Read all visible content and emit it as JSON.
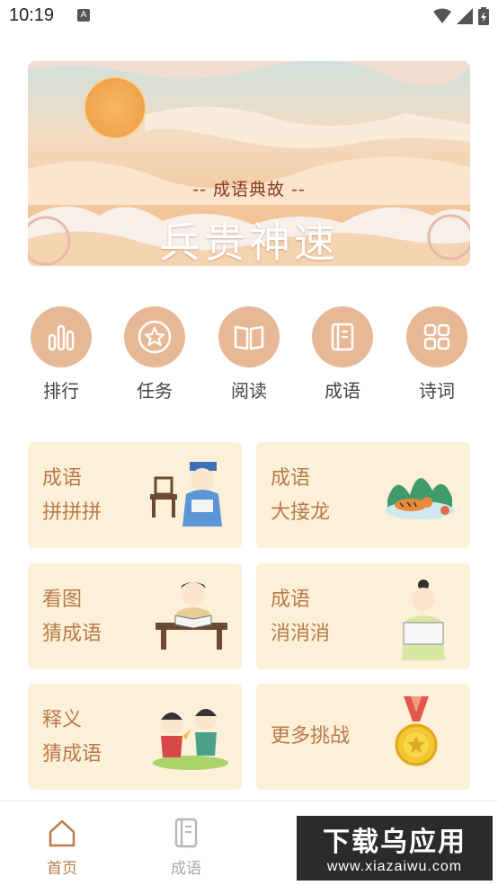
{
  "status": {
    "time": "10:19",
    "a_icon": "A"
  },
  "banner": {
    "subtitle": "-- 成语典故 --",
    "title": "兵贵神速"
  },
  "quick": [
    {
      "label": "排行",
      "icon": "bar-chart-icon"
    },
    {
      "label": "任务",
      "icon": "star-circle-icon"
    },
    {
      "label": "阅读",
      "icon": "open-book-icon"
    },
    {
      "label": "成语",
      "icon": "notebook-icon"
    },
    {
      "label": "诗词",
      "icon": "grid-icon"
    }
  ],
  "cards": [
    {
      "line1": "成语",
      "line2": "拼拼拼"
    },
    {
      "line1": "成语",
      "line2": "大接龙"
    },
    {
      "line1": "看图",
      "line2": "猜成语"
    },
    {
      "line1": "成语",
      "line2": "消消消"
    },
    {
      "line1": "释义",
      "line2": "猜成语"
    },
    {
      "line1": "更多挑战"
    }
  ],
  "nav": [
    {
      "label": "首页",
      "active": true
    },
    {
      "label": "成语",
      "active": false
    }
  ],
  "watermark": {
    "line1": "下载乌应用",
    "line2": "www.xiazaiwu.com"
  },
  "colors": {
    "accent": "#e7b896",
    "card_bg": "#fdf0d8",
    "card_text": "#b87a4a",
    "nav_active": "#b87a4a"
  }
}
